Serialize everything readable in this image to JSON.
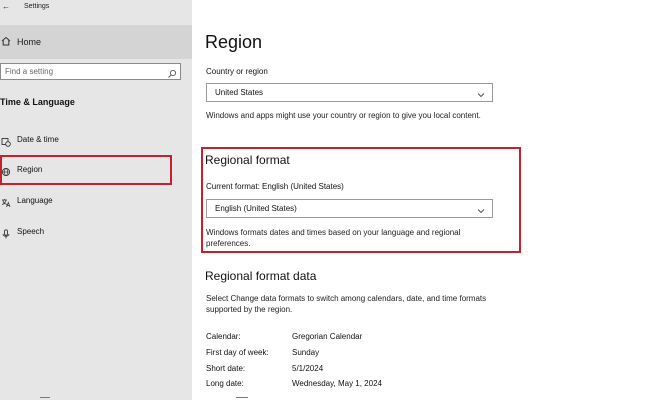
{
  "window": {
    "title": "Settings",
    "back_icon": "back-arrow-icon"
  },
  "sidebar": {
    "home_label": "Home",
    "search_placeholder": "Find a setting",
    "section_heading": "Time & Language",
    "items": [
      {
        "label": "Date & time",
        "icon": "calendar-clock-icon"
      },
      {
        "label": "Region",
        "icon": "globe-region-icon",
        "selected": true
      },
      {
        "label": "Language",
        "icon": "language-icon"
      },
      {
        "label": "Speech",
        "icon": "microphone-icon"
      }
    ]
  },
  "main": {
    "title": "Region",
    "country": {
      "label": "Country or region",
      "value": "United States",
      "description": "Windows and apps might use your country or region to give you local content."
    },
    "regional_format": {
      "heading": "Regional format",
      "current_label": "Current format: English (United States)",
      "value": "English (United States)",
      "description": "Windows formats dates and times based on your language and regional preferences."
    },
    "format_data": {
      "heading": "Regional format data",
      "description": "Select Change data formats to switch among calendars, date, and time formats supported by the region.",
      "rows": [
        {
          "key": "Calendar:",
          "value": "Gregorian Calendar"
        },
        {
          "key": "First day of week:",
          "value": "Sunday"
        },
        {
          "key": "Short date:",
          "value": "5/1/2024"
        },
        {
          "key": "Long date:",
          "value": "Wednesday, May 1, 2024"
        }
      ]
    }
  },
  "colors": {
    "highlight_border": "#c8202c",
    "sidebar_bg": "#e6e6e6",
    "selected_bg": "#d4d4d4"
  }
}
